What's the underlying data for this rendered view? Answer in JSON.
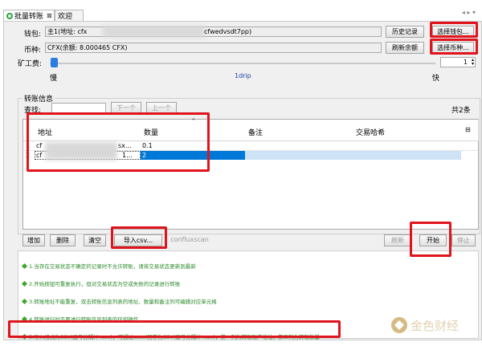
{
  "tabs": [
    {
      "label": "批量转账",
      "close": "⊠"
    },
    {
      "label": "欢迎"
    }
  ],
  "nav_arrows": "◂ ▸ ▾",
  "wallet": {
    "label": "钱包:",
    "value_prefix": "主1(地址: cfx",
    "value_suffix": "cfwedvsdt7pp)",
    "history_button": "历史记录",
    "select_button": "选择钱包..."
  },
  "currency": {
    "label": "币种:",
    "value": "CFX(余额: 8.000465 CFX)",
    "refresh_button": "刷新余额",
    "select_button": "选择币种..."
  },
  "fee": {
    "label": "矿工费:",
    "slow": "慢",
    "mid": "1drip",
    "fast": "快",
    "value": "1",
    "slider_level": 0
  },
  "transfer": {
    "section_title": "转账信息",
    "search_label": "查找:",
    "search_value": "",
    "next_button": "下一个",
    "prev_button": "上一个",
    "total": "共2条",
    "columns": [
      "地址",
      "数量",
      "备注",
      "交易哈希"
    ],
    "rows": [
      {
        "num": "1",
        "address_prefix": "cf",
        "address_suffix": "sx...",
        "amount": "0.1",
        "note": "",
        "hash": ""
      },
      {
        "num": "2",
        "address_prefix": "cf",
        "address_suffix": "1...",
        "amount": "2",
        "note": "",
        "hash": ""
      }
    ]
  },
  "toolbar": {
    "add": "增加",
    "delete": "删除",
    "clear": "清空",
    "import": "导入csv...",
    "scan": "confluxscan",
    "refresh": "刷新",
    "start": "开始",
    "stop": "停止"
  },
  "tips": [
    "1.当存在交易状态不确定的记录时不允许转账，请将交易状态更新到最新",
    "2.开始按钮可重复执行，但对交易状态为空或失败的记录进行转账",
    "3.转账地址不能重复，双击转账信息列表的地址、数量和备注列可编辑对应单元格",
    "4.转账进行时不要进行转账信息列表的任何操作",
    "5.导入格式为CSV(逗号分隔)(*.csv)，可通过excel另存为CSV(逗号分隔)(*.csv)，第一列为转账账户地址，第二列为转账数量"
  ],
  "watermark": "金色财经",
  "colors": {
    "accent": "#2ea23b",
    "highlight": "#0078d7",
    "annotation": "#e0141c",
    "tip_text": "#2c8a2c"
  }
}
